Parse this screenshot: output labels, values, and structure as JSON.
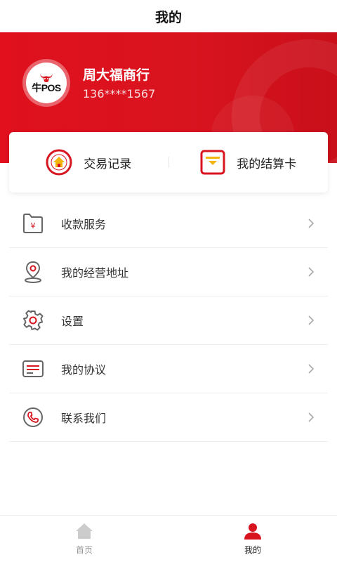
{
  "header": {
    "title": "我的"
  },
  "profile": {
    "logo_text": "牛POS",
    "name": "周大福商行",
    "phone": "136****1567"
  },
  "quick_actions": [
    {
      "label": "交易记录",
      "icon": "home-circle-icon"
    },
    {
      "label": "我的结算卡",
      "icon": "card-icon"
    }
  ],
  "menu": [
    {
      "label": "收款服务",
      "icon": "wallet-yuan-icon"
    },
    {
      "label": "我的经营地址",
      "icon": "location-pin-icon"
    },
    {
      "label": "设置",
      "icon": "gear-icon"
    },
    {
      "label": "我的协议",
      "icon": "document-icon"
    },
    {
      "label": "联系我们",
      "icon": "phone-icon"
    }
  ],
  "tabbar": [
    {
      "label": "首页",
      "icon": "home-icon",
      "active": false
    },
    {
      "label": "我的",
      "icon": "user-icon",
      "active": true
    }
  ],
  "colors": {
    "brand_red": "#d8141f",
    "gold": "#f2b40d",
    "icon_gray": "#666666",
    "inactive_tab": "#cccccc"
  }
}
